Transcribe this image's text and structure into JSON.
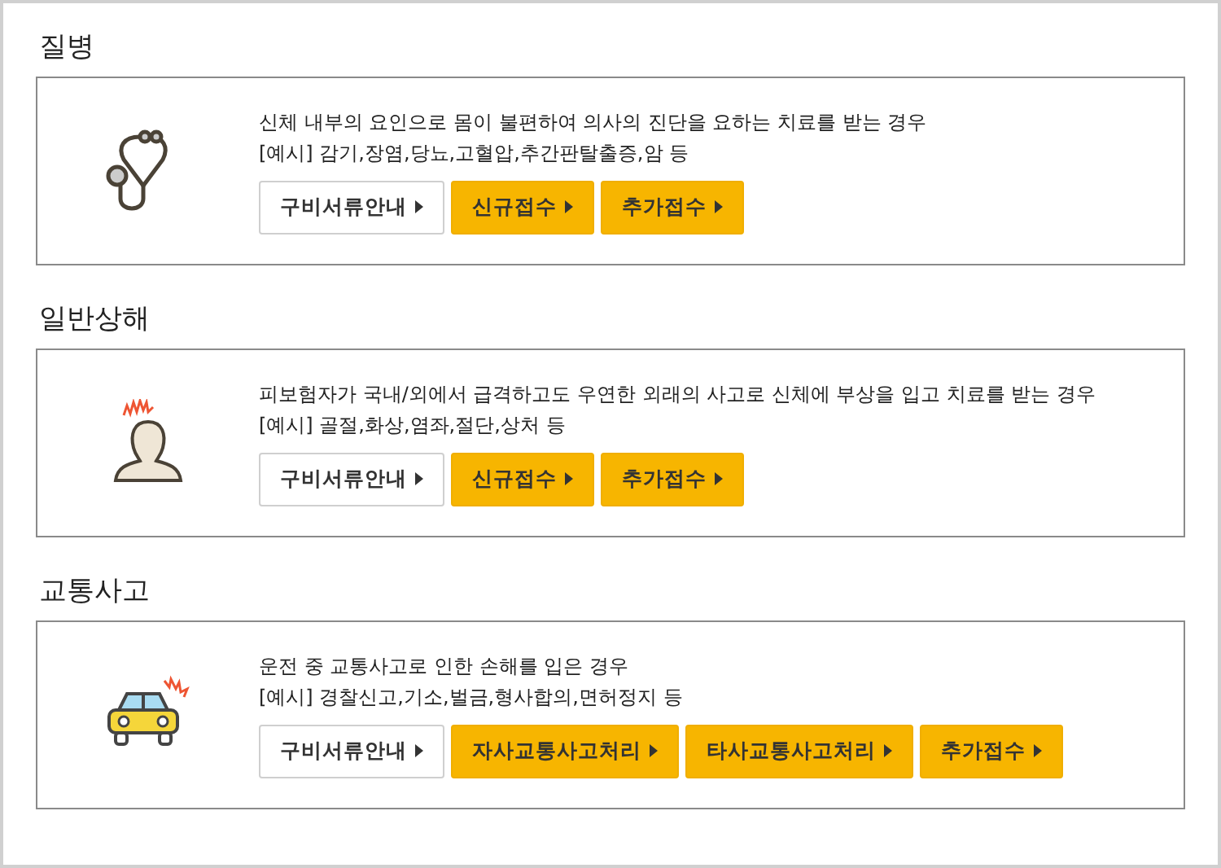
{
  "sections": [
    {
      "title": "질병",
      "kind": "stethoscope",
      "description": "신체 내부의 요인으로 몸이 불편하여 의사의 진단을 요하는 치료를 받는 경우",
      "example": "[예시] 감기,장염,당뇨,고혈압,추간판탈출증,암 등",
      "buttons": [
        {
          "label": "구비서류안내",
          "kind": "outline"
        },
        {
          "label": "신규접수",
          "kind": "filled"
        },
        {
          "label": "추가접수",
          "kind": "filled"
        }
      ]
    },
    {
      "title": "일반상해",
      "kind": "person",
      "description": "피보험자가 국내/외에서 급격하고도 우연한 외래의 사고로 신체에 부상을 입고 치료를 받는 경우",
      "example": "[예시] 골절,화상,염좌,절단,상처 등",
      "buttons": [
        {
          "label": "구비서류안내",
          "kind": "outline"
        },
        {
          "label": "신규접수",
          "kind": "filled"
        },
        {
          "label": "추가접수",
          "kind": "filled"
        }
      ]
    },
    {
      "title": "교통사고",
      "kind": "car",
      "description": "운전 중 교통사고로 인한 손해를 입은 경우",
      "example": "[예시] 경찰신고,기소,벌금,형사합의,면허정지 등",
      "buttons": [
        {
          "label": "구비서류안내",
          "kind": "outline"
        },
        {
          "label": "자사교통사고처리",
          "kind": "filled"
        },
        {
          "label": "타사교통사고처리",
          "kind": "filled"
        },
        {
          "label": "추가접수",
          "kind": "filled"
        }
      ]
    }
  ]
}
